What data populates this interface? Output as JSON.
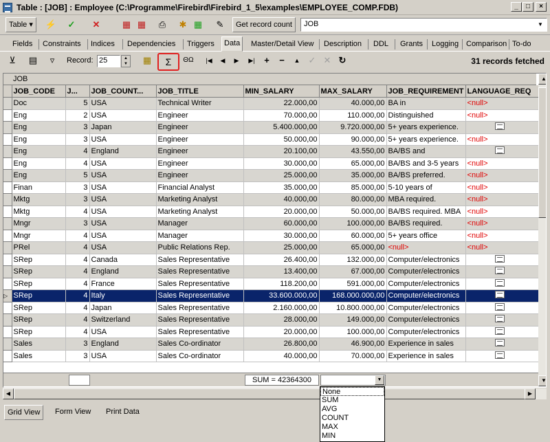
{
  "window": {
    "title": "Table : [JOB] : Employee (C:\\Programme\\Firebird\\Firebird_1_5\\examples\\EMPLOYEE_COMP.FDB)"
  },
  "toolbar": {
    "table_label": "Table",
    "get_record_count": "Get record count",
    "table_select_value": "JOB"
  },
  "tabs": [
    "Fields",
    "Constraints",
    "Indices",
    "Dependencies",
    "Triggers",
    "Data",
    "Master/Detail View",
    "Description",
    "DDL",
    "Grants",
    "Logging",
    "Comparison",
    "To-do"
  ],
  "active_tab": "Data",
  "datanav": {
    "record_label": "Record:",
    "record_value": "25",
    "sum_symbol": "Σ",
    "omega": "ΘΩ",
    "records_fetched": "31 records fetched"
  },
  "grid": {
    "caption": "JOB",
    "columns": [
      "JOB_CODE",
      "J...",
      "JOB_COUNT...",
      "JOB_TITLE",
      "MIN_SALARY",
      "MAX_SALARY",
      "JOB_REQUIREMENT",
      "LANGUAGE_REQ"
    ],
    "rows": [
      [
        "Doc",
        "5",
        "USA",
        "Technical Writer",
        "22.000,00",
        "40.000,00",
        "BA in",
        "<null>"
      ],
      [
        "Eng",
        "2",
        "USA",
        "Engineer",
        "70.000,00",
        "110.000,00",
        "Distinguished",
        "<null>"
      ],
      [
        "Eng",
        "3",
        "Japan",
        "Engineer",
        "5.400.000,00",
        "9.720.000,00",
        "5+ years experience.",
        "memo"
      ],
      [
        "Eng",
        "3",
        "USA",
        "Engineer",
        "50.000,00",
        "90.000,00",
        "5+ years experience.",
        "<null>"
      ],
      [
        "Eng",
        "4",
        "England",
        "Engineer",
        "20.100,00",
        "43.550,00",
        "BA/BS and",
        "memo"
      ],
      [
        "Eng",
        "4",
        "USA",
        "Engineer",
        "30.000,00",
        "65.000,00",
        "BA/BS and 3-5 years",
        "<null>"
      ],
      [
        "Eng",
        "5",
        "USA",
        "Engineer",
        "25.000,00",
        "35.000,00",
        "BA/BS preferred.",
        "<null>"
      ],
      [
        "Finan",
        "3",
        "USA",
        "Financial Analyst",
        "35.000,00",
        "85.000,00",
        "5-10 years of",
        "<null>"
      ],
      [
        "Mktg",
        "3",
        "USA",
        "Marketing Analyst",
        "40.000,00",
        "80.000,00",
        "MBA required.",
        "<null>"
      ],
      [
        "Mktg",
        "4",
        "USA",
        "Marketing Analyst",
        "20.000,00",
        "50.000,00",
        "BA/BS required.  MBA",
        "<null>"
      ],
      [
        "Mngr",
        "3",
        "USA",
        "Manager",
        "60.000,00",
        "100.000,00",
        "BA/BS required.",
        "<null>"
      ],
      [
        "Mngr",
        "4",
        "USA",
        "Manager",
        "30.000,00",
        "60.000,00",
        "5+ years office",
        "<null>"
      ],
      [
        "PRel",
        "4",
        "USA",
        "Public Relations Rep.",
        "25.000,00",
        "65.000,00",
        "<null>",
        "<null>"
      ],
      [
        "SRep",
        "4",
        "Canada",
        "Sales Representative",
        "26.400,00",
        "132.000,00",
        "Computer/electronics",
        "memo"
      ],
      [
        "SRep",
        "4",
        "England",
        "Sales Representative",
        "13.400,00",
        "67.000,00",
        "Computer/electronics",
        "memo"
      ],
      [
        "SRep",
        "4",
        "France",
        "Sales Representative",
        "118.200,00",
        "591.000,00",
        "Computer/electronics",
        "memo"
      ],
      [
        "SRep",
        "4",
        "Italy",
        "Sales Representative",
        "33.600.000,00",
        "168.000.000,00",
        "Computer/electronics",
        "memo"
      ],
      [
        "SRep",
        "4",
        "Japan",
        "Sales Representative",
        "2.160.000,00",
        "10.800.000,00",
        "Computer/electronics",
        "memo"
      ],
      [
        "SRep",
        "4",
        "Switzerland",
        "Sales Representative",
        "28.000,00",
        "149.000,00",
        "Computer/electronics",
        "memo"
      ],
      [
        "SRep",
        "4",
        "USA",
        "Sales Representative",
        "20.000,00",
        "100.000,00",
        "Computer/electronics",
        "memo"
      ],
      [
        "Sales",
        "3",
        "England",
        "Sales Co-ordinator",
        "26.800,00",
        "46.900,00",
        "Experience in sales",
        "memo"
      ],
      [
        "Sales",
        "3",
        "USA",
        "Sales Co-ordinator",
        "40.000,00",
        "70.000,00",
        "Experience in sales",
        "memo"
      ]
    ],
    "selected_row": 16,
    "sum_text": "SUM = 42364300"
  },
  "aggregate_options": [
    "None",
    "SUM",
    "AVG",
    "COUNT",
    "MAX",
    "MIN"
  ],
  "bottom_tabs": [
    "Grid View",
    "Form View",
    "Print Data"
  ]
}
